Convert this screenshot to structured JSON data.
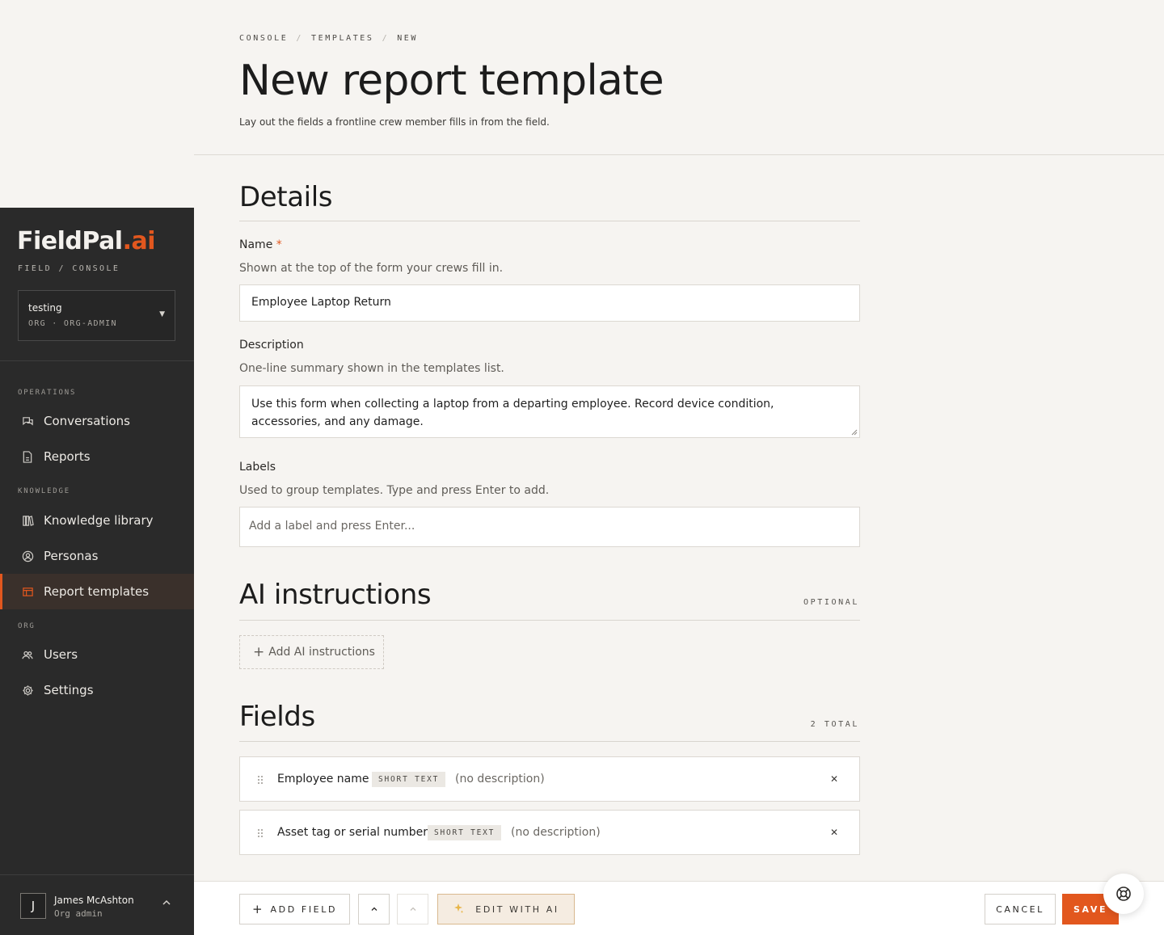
{
  "brand": {
    "name": "FieldPal",
    "suffix": ".ai",
    "tagline": "FIELD / CONSOLE",
    "accent": "#e2571e"
  },
  "org": {
    "name": "testing",
    "role": "ORG · ORG-ADMIN"
  },
  "nav": {
    "sections": {
      "operations": "OPERATIONS",
      "knowledge": "KNOWLEDGE",
      "org": "ORG"
    },
    "items": [
      {
        "label": "Conversations",
        "icon": "chat-icon"
      },
      {
        "label": "Reports",
        "icon": "document-icon"
      },
      {
        "label": "Knowledge library",
        "icon": "library-icon"
      },
      {
        "label": "Personas",
        "icon": "persona-icon"
      },
      {
        "label": "Report templates",
        "icon": "template-icon",
        "active": true
      },
      {
        "label": "Users",
        "icon": "users-icon"
      },
      {
        "label": "Settings",
        "icon": "gear-icon"
      }
    ]
  },
  "user": {
    "initial": "J",
    "name": "James McAshton",
    "role": "Org admin"
  },
  "breadcrumb": [
    "CONSOLE",
    "TEMPLATES",
    "NEW"
  ],
  "page": {
    "title": "New report template",
    "subtitle": "Lay out the fields a frontline crew member fills in from the field."
  },
  "details": {
    "title": "Details",
    "name": {
      "label": "Name",
      "required": "*",
      "help": "Shown at the top of the form your crews fill in.",
      "value": "Employee Laptop Return"
    },
    "description": {
      "label": "Description",
      "help": "One-line summary shown in the templates list.",
      "value": "Use this form when collecting a laptop from a departing employee. Record device condition, accessories, and any damage."
    },
    "labels": {
      "label": "Labels",
      "help": "Used to group templates. Type and press Enter to add.",
      "placeholder": "Add a label and press Enter..."
    }
  },
  "ai_instructions": {
    "title": "AI instructions",
    "badge": "OPTIONAL",
    "add_label": "Add AI instructions"
  },
  "fields": {
    "title": "Fields",
    "total": "2 TOTAL",
    "items": [
      {
        "name": "Employee name",
        "type": "SHORT TEXT",
        "description": "(no description)"
      },
      {
        "name": "Asset tag or serial number",
        "type": "SHORT TEXT",
        "description": "(no description)"
      }
    ]
  },
  "toolbar": {
    "add_field": "ADD FIELD",
    "edit_with_ai": "EDIT WITH AI",
    "cancel": "CANCEL",
    "save": "SAVE"
  }
}
